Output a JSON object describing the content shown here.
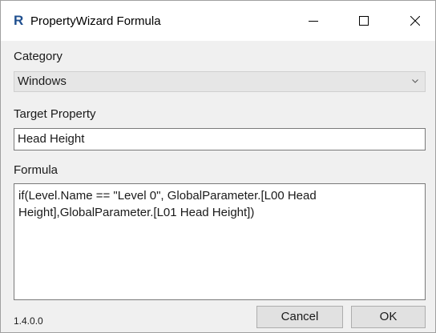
{
  "window": {
    "title": "PropertyWizard Formula",
    "app_icon_letter": "R",
    "icons": {
      "app": "revit-logo-icon",
      "minimize": "minimize-icon",
      "maximize": "maximize-icon",
      "close": "close-icon"
    }
  },
  "category": {
    "label": "Category",
    "selected": "Windows",
    "icon": "chevron-down-icon"
  },
  "target_property": {
    "label": "Target Property",
    "value": "Head Height"
  },
  "formula": {
    "label": "Formula",
    "value": "if(Level.Name == \"Level 0\", GlobalParameter.[L00 Head Height],GlobalParameter.[L01 Head Height])"
  },
  "footer": {
    "version": "1.4.0.0",
    "cancel_label": "Cancel",
    "ok_label": "OK"
  }
}
